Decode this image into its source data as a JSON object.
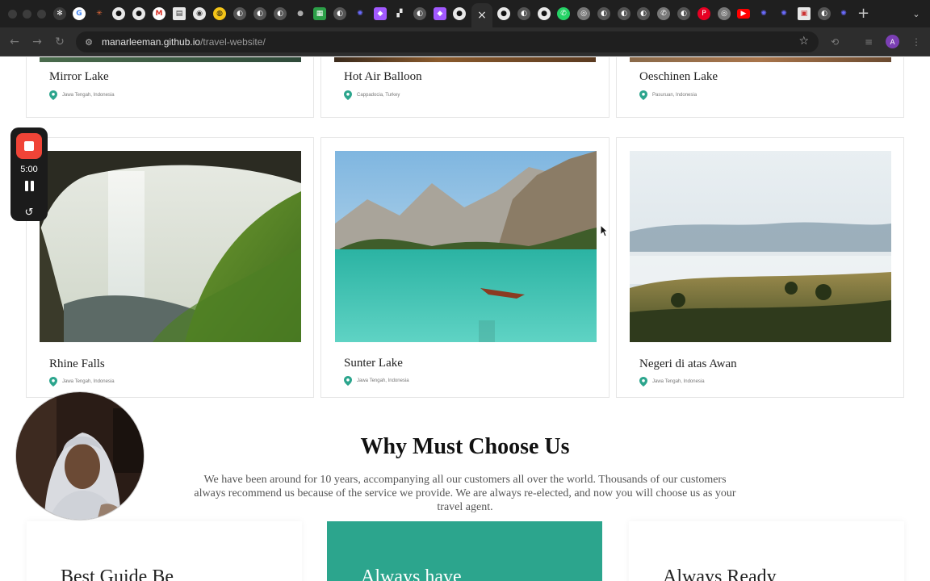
{
  "browser": {
    "url_host": "manarleeman.github.io",
    "url_path": "/travel-website/",
    "active_tab_close": "×",
    "new_tab": "+",
    "profile_initial": "A"
  },
  "recorder": {
    "time": "5:00"
  },
  "cards_top": [
    {
      "title": "Mirror Lake",
      "location": "Jawa Tengah, Indonesia"
    },
    {
      "title": "Hot Air Balloon",
      "location": "Cappadocia, Turkey"
    },
    {
      "title": "Oeschinen Lake",
      "location": "Pasuruan, Indonesia"
    }
  ],
  "cards_bottom": [
    {
      "title": "Rhine Falls",
      "location": "Jawa Tengah, Indonesia",
      "image": "waterfall-photo"
    },
    {
      "title": "Sunter Lake",
      "location": "Jawa Tengah, Indonesia",
      "image": "lake-boat-photo"
    },
    {
      "title": "Negeri di atas Awan",
      "location": "Jawa Tengah, Indonesia",
      "image": "foggy-valley-photo"
    }
  ],
  "why_section": {
    "title": "Why Must Choose Us",
    "description": "We have been around for 10 years, accompanying all our customers all over the world. Thousands of our customers always recommend us because of the service we provide. We are always re-elected, and now you will choose us as your travel agent."
  },
  "features": [
    {
      "title": "Best Guide Be"
    },
    {
      "title": "Always have"
    },
    {
      "title": "Always Ready"
    }
  ],
  "colors": {
    "accent_teal": "#2ca58d",
    "pin": "#2ca58d",
    "recorder_red": "#f04437"
  }
}
